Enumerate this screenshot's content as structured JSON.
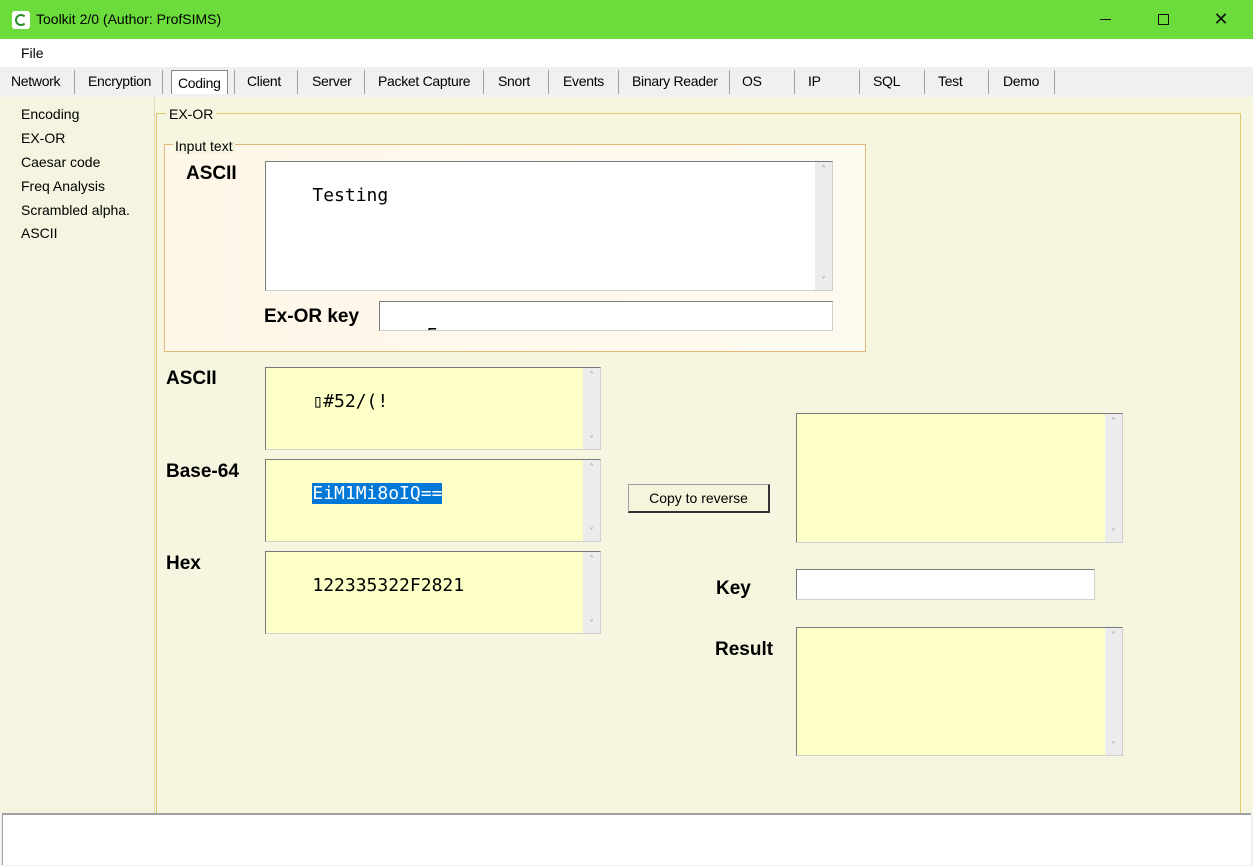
{
  "window": {
    "title": "Toolkit 2/0 (Author: ProfSIMS)",
    "minimize": "—",
    "maximize": "☐",
    "close": "✕",
    "accent_color": "#6bdc3c"
  },
  "menu": {
    "file": "File"
  },
  "tabs": [
    {
      "label": "Network"
    },
    {
      "label": "Encryption"
    },
    {
      "label": "Coding",
      "active": true
    },
    {
      "label": "Client"
    },
    {
      "label": "Server"
    },
    {
      "label": "Packet Capture"
    },
    {
      "label": "Snort"
    },
    {
      "label": "Events"
    },
    {
      "label": "Binary Reader"
    },
    {
      "label": "OS"
    },
    {
      "label": "IP"
    },
    {
      "label": "SQL"
    },
    {
      "label": "Test"
    },
    {
      "label": "Demo"
    }
  ],
  "sidebar": {
    "items": [
      {
        "label": "Encoding"
      },
      {
        "label": "EX-OR"
      },
      {
        "label": "Caesar code"
      },
      {
        "label": "Freq Analysis"
      },
      {
        "label": "Scrambled alpha."
      },
      {
        "label": "ASCII"
      }
    ]
  },
  "exor": {
    "group_title": "EX-OR",
    "input_group_title": "Input text",
    "ascii_label": "ASCII",
    "input_text": "Testing",
    "key_label": "Ex-OR key",
    "key_value": "F",
    "out_ascii_label": "ASCII",
    "out_ascii_value": "▯#52/(!",
    "base64_label": "Base-64",
    "base64_value": "EiM1Mi8oIQ==",
    "hex_label": "Hex",
    "hex_value": "122335322F2821",
    "copy_button": "Copy to reverse",
    "reverse_value": "",
    "rev_key_label": "Key",
    "rev_key_value": "",
    "result_label": "Result",
    "result_value": ""
  },
  "scroll": {
    "up": "˄",
    "down": "˅"
  },
  "status": {
    "text": ""
  }
}
